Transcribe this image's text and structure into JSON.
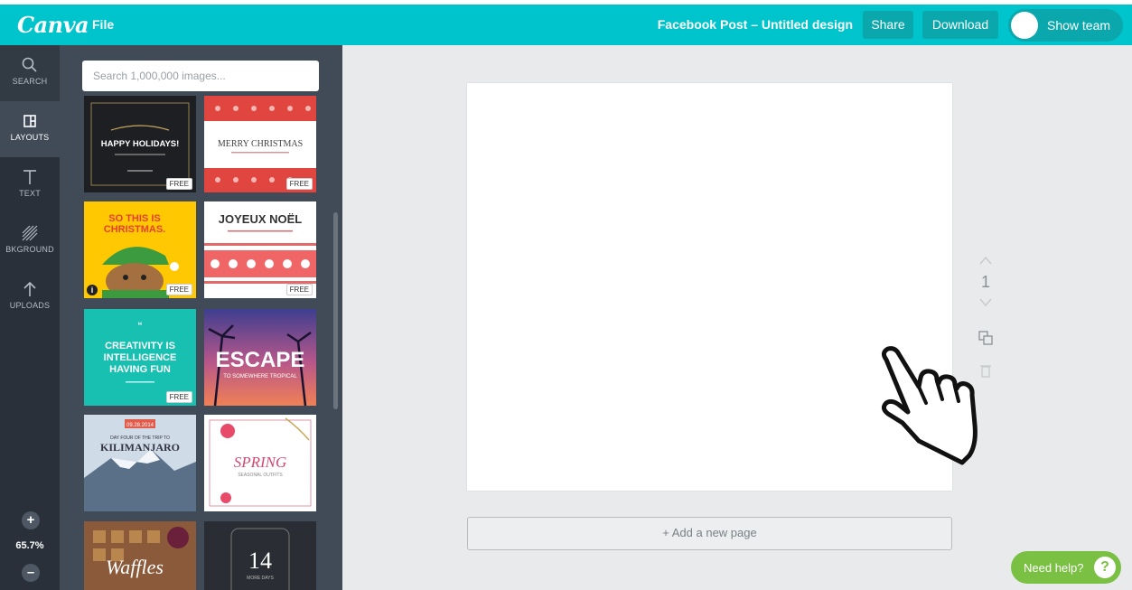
{
  "app": {
    "logo": "Canva",
    "file_menu": "File",
    "doc_title": "Facebook Post – Untitled design",
    "share": "Share",
    "download": "Download",
    "show_team": "Show team"
  },
  "rail": {
    "items": [
      {
        "label": "SEARCH",
        "icon": "search-icon"
      },
      {
        "label": "LAYOUTS",
        "icon": "layouts-icon"
      },
      {
        "label": "TEXT",
        "icon": "text-icon"
      },
      {
        "label": "BKGROUND",
        "icon": "background-icon"
      },
      {
        "label": "UPLOADS",
        "icon": "upload-icon"
      }
    ],
    "zoom_in": "+",
    "zoom_level": "65.7%",
    "zoom_out": "–"
  },
  "panel": {
    "search_placeholder": "Search 1,000,000 images...",
    "free_label": "FREE",
    "info_label": "i",
    "layouts": [
      {
        "lines": [
          "HAPPY HOLIDAYS!"
        ]
      },
      {
        "lines": [
          "MERRY CHRISTMAS"
        ]
      },
      {
        "lines": [
          "SO THIS IS",
          "CHRISTMAS."
        ]
      },
      {
        "lines": [
          "JOYEUX NOËL"
        ]
      },
      {
        "lines": [
          "“",
          "CREATIVITY IS",
          "INTELLIGENCE",
          "HAVING FUN"
        ]
      },
      {
        "lines": [
          "ESCAPE",
          "TO SOMEWHERE TROPICAL"
        ]
      },
      {
        "lines": [
          "09.28.2014",
          "DAY FOUR OF THE TRIP TO",
          "KILIMANJARO"
        ]
      },
      {
        "lines": [
          "SPRING",
          "SEASONAL OUTFITS"
        ]
      },
      {
        "lines": [
          "Waffles"
        ]
      },
      {
        "lines": [
          "14",
          "MORE DAYS"
        ]
      }
    ]
  },
  "workspace": {
    "page_number": "1",
    "add_page": "+ Add a new page",
    "need_help": "Need help?",
    "help_icon": "?"
  },
  "colors": {
    "topbar": "#00c4cc",
    "rail": "#293039",
    "panel": "#414b57",
    "workspace": "#e8eaeb",
    "help": "#7ac043"
  }
}
